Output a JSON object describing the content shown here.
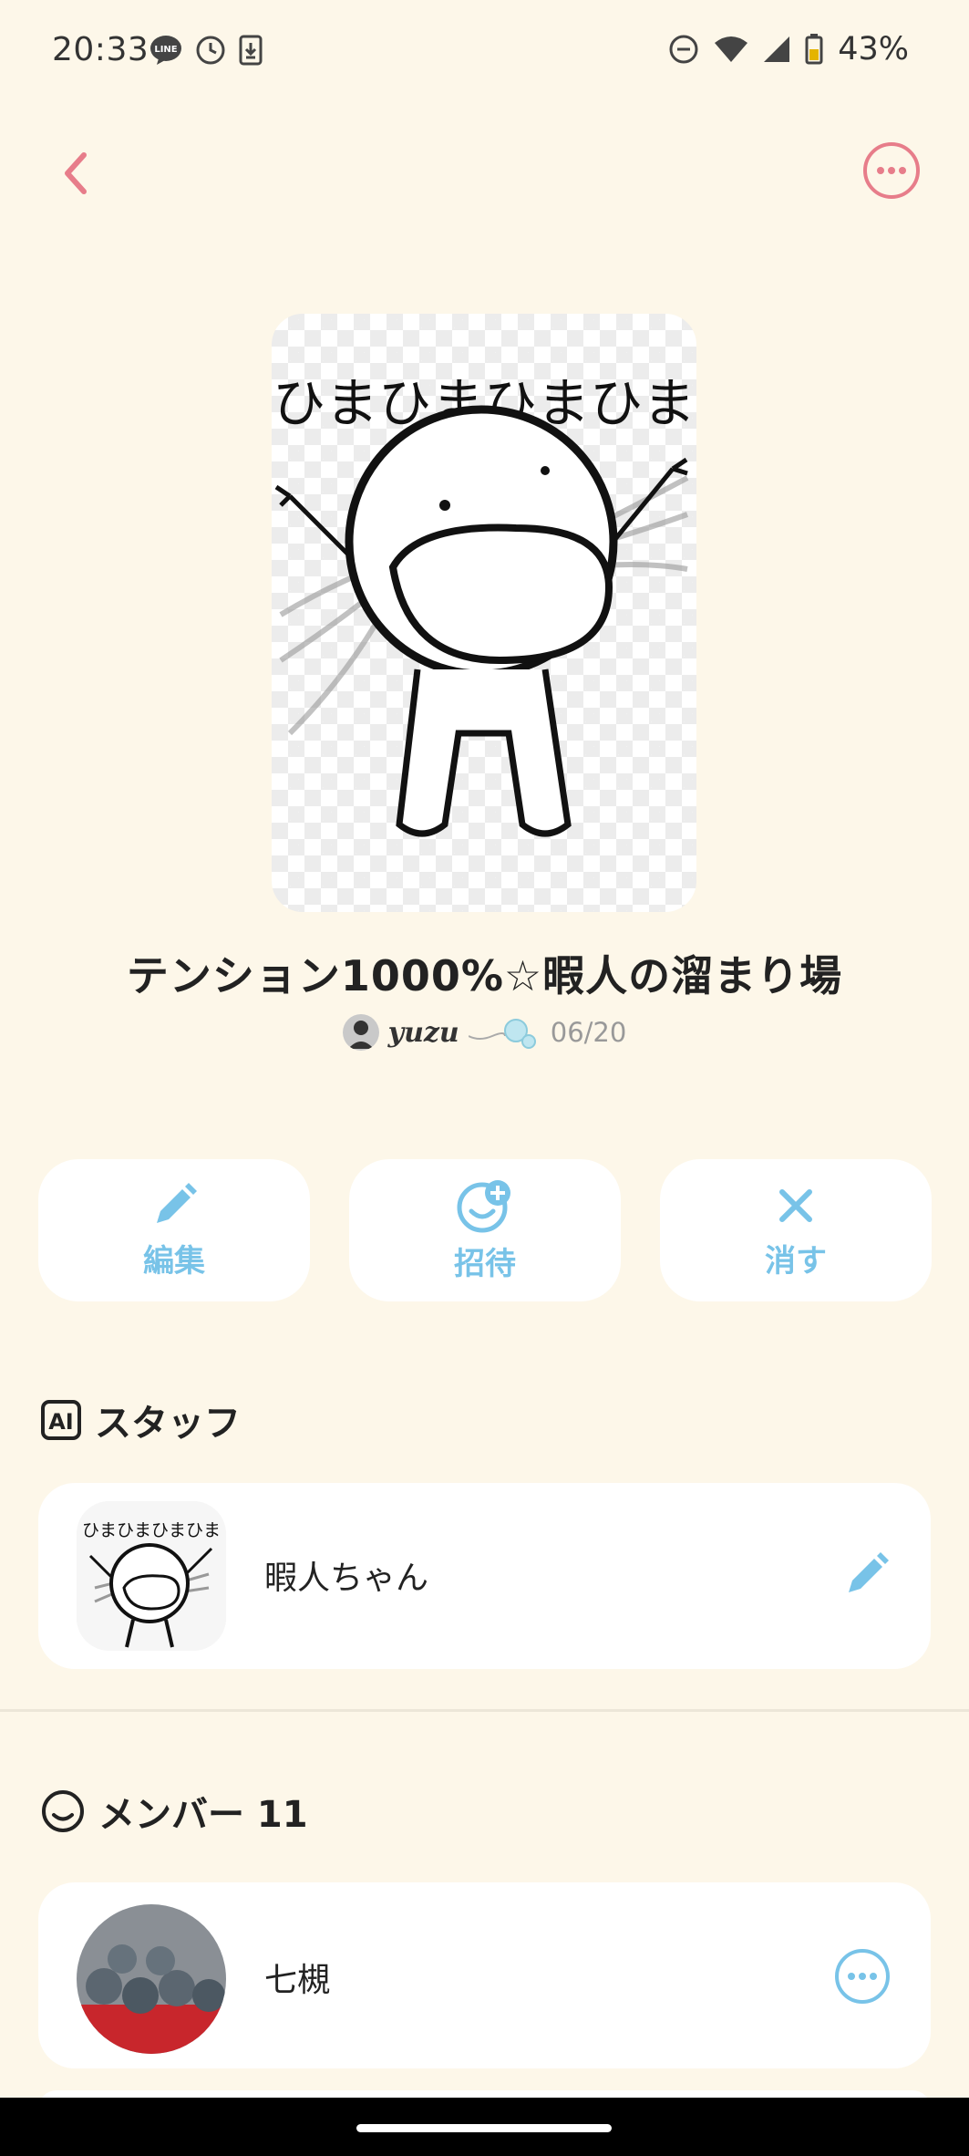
{
  "status_bar": {
    "time": "20:33",
    "battery": "43%"
  },
  "room": {
    "title": "テンション1000%☆暇人の溜まり場",
    "owner_name": "yuzu",
    "date": "06/20",
    "cover_text": "ひまひまひまひま"
  },
  "actions": [
    {
      "label": "編集",
      "icon": "pencil-icon"
    },
    {
      "label": "招待",
      "icon": "invite-face-icon"
    },
    {
      "label": "消す",
      "icon": "close-icon"
    }
  ],
  "staff": {
    "section_icon": "ai-icon",
    "section_title": "スタッフ",
    "member": {
      "name": "暇人ちゃん",
      "thumb_text": "ひまひまひまひま"
    }
  },
  "members": {
    "section_icon": "smile-icon",
    "section_title": "メンバー 11",
    "items": [
      {
        "name": "七槻"
      }
    ]
  },
  "colors": {
    "background": "#fdf7e9",
    "accent_pink": "#e77d8a",
    "accent_blue": "#78c3e8"
  }
}
